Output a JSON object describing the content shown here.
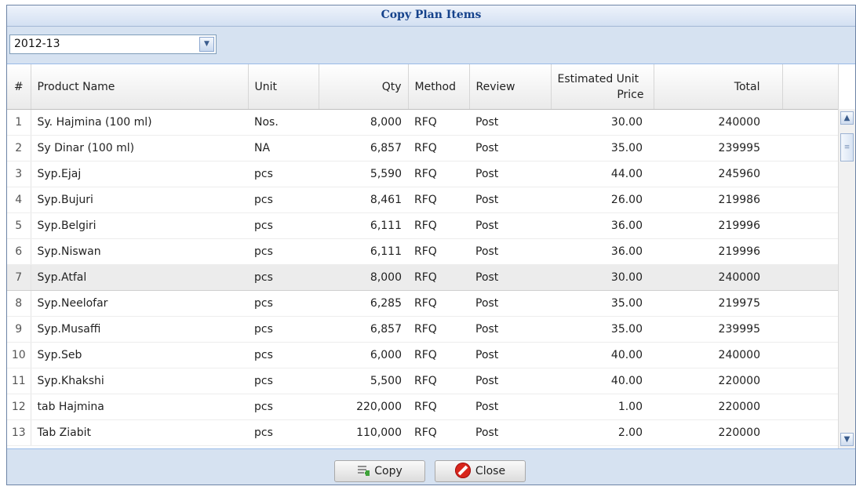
{
  "dialog": {
    "title": "Copy Plan Items"
  },
  "toolbar": {
    "year_value": "2012-13"
  },
  "grid": {
    "headers": {
      "index": "#",
      "product": "Product Name",
      "unit": "Unit",
      "qty": "Qty",
      "method": "Method",
      "review": "Review",
      "price_line1": "Estimated Unit",
      "price_line2": "Price",
      "total": "Total"
    },
    "rows": [
      {
        "n": "1",
        "product": "Sy. Hajmina (100 ml)",
        "unit": "Nos.",
        "qty": "8,000",
        "method": "RFQ",
        "review": "Post",
        "price": "30.00",
        "total": "240000"
      },
      {
        "n": "2",
        "product": "Sy Dinar (100 ml)",
        "unit": "NA",
        "qty": "6,857",
        "method": "RFQ",
        "review": "Post",
        "price": "35.00",
        "total": "239995"
      },
      {
        "n": "3",
        "product": "Syp.Ejaj",
        "unit": "pcs",
        "qty": "5,590",
        "method": "RFQ",
        "review": "Post",
        "price": "44.00",
        "total": "245960"
      },
      {
        "n": "4",
        "product": "Syp.Bujuri",
        "unit": "pcs",
        "qty": "8,461",
        "method": "RFQ",
        "review": "Post",
        "price": "26.00",
        "total": "219986"
      },
      {
        "n": "5",
        "product": "Syp.Belgiri",
        "unit": "pcs",
        "qty": "6,111",
        "method": "RFQ",
        "review": "Post",
        "price": "36.00",
        "total": "219996"
      },
      {
        "n": "6",
        "product": "Syp.Niswan",
        "unit": "pcs",
        "qty": "6,111",
        "method": "RFQ",
        "review": "Post",
        "price": "36.00",
        "total": "219996"
      },
      {
        "n": "7",
        "product": "Syp.Atfal",
        "unit": "pcs",
        "qty": "8,000",
        "method": "RFQ",
        "review": "Post",
        "price": "30.00",
        "total": "240000",
        "selected": true
      },
      {
        "n": "8",
        "product": "Syp.Neelofar",
        "unit": "pcs",
        "qty": "6,285",
        "method": "RFQ",
        "review": "Post",
        "price": "35.00",
        "total": "219975"
      },
      {
        "n": "9",
        "product": "Syp.Musaffi",
        "unit": "pcs",
        "qty": "6,857",
        "method": "RFQ",
        "review": "Post",
        "price": "35.00",
        "total": "239995"
      },
      {
        "n": "10",
        "product": "Syp.Seb",
        "unit": "pcs",
        "qty": "6,000",
        "method": "RFQ",
        "review": "Post",
        "price": "40.00",
        "total": "240000"
      },
      {
        "n": "11",
        "product": "Syp.Khakshi",
        "unit": "pcs",
        "qty": "5,500",
        "method": "RFQ",
        "review": "Post",
        "price": "40.00",
        "total": "220000"
      },
      {
        "n": "12",
        "product": "tab Hajmina",
        "unit": "pcs",
        "qty": "220,000",
        "method": "RFQ",
        "review": "Post",
        "price": "1.00",
        "total": "220000"
      },
      {
        "n": "13",
        "product": "Tab Ziabit",
        "unit": "pcs",
        "qty": "110,000",
        "method": "RFQ",
        "review": "Post",
        "price": "2.00",
        "total": "220000"
      }
    ]
  },
  "footer": {
    "copy_label": "Copy",
    "close_label": "Close"
  },
  "icons": {
    "copy": "copy-add-icon",
    "close": "close-circle-icon",
    "combo_trigger": "chevron-down-icon",
    "scroll_up": "arrow-up-icon",
    "scroll_down": "arrow-down-icon"
  }
}
